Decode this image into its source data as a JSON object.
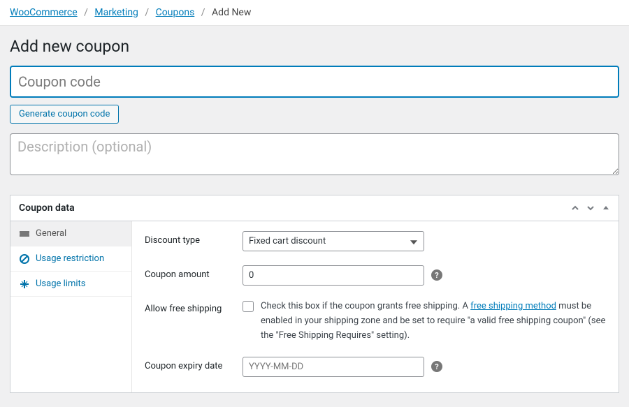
{
  "breadcrumb": {
    "items": [
      "WooCommerce",
      "Marketing",
      "Coupons"
    ],
    "current": "Add New"
  },
  "page_title": "Add new coupon",
  "coupon_code": {
    "value": "",
    "placeholder": "Coupon code"
  },
  "generate_button_label": "Generate coupon code",
  "description": {
    "value": "",
    "placeholder": "Description (optional)"
  },
  "panel": {
    "title": "Coupon data",
    "tabs": [
      {
        "key": "general",
        "label": "General",
        "active": true
      },
      {
        "key": "restriction",
        "label": "Usage restriction",
        "active": false
      },
      {
        "key": "limits",
        "label": "Usage limits",
        "active": false
      }
    ],
    "fields": {
      "discount_type": {
        "label": "Discount type",
        "selected": "Fixed cart discount"
      },
      "coupon_amount": {
        "label": "Coupon amount",
        "value": "0"
      },
      "free_shipping": {
        "label": "Allow free shipping",
        "checked": false,
        "text_before": "Check this box if the coupon grants free shipping. A ",
        "link_text": "free shipping method",
        "text_after": " must be enabled in your shipping zone and be set to require \"a valid free shipping coupon\" (see the \"Free Shipping Requires\" setting)."
      },
      "expiry": {
        "label": "Coupon expiry date",
        "value": "",
        "placeholder": "YYYY-MM-DD"
      }
    }
  }
}
